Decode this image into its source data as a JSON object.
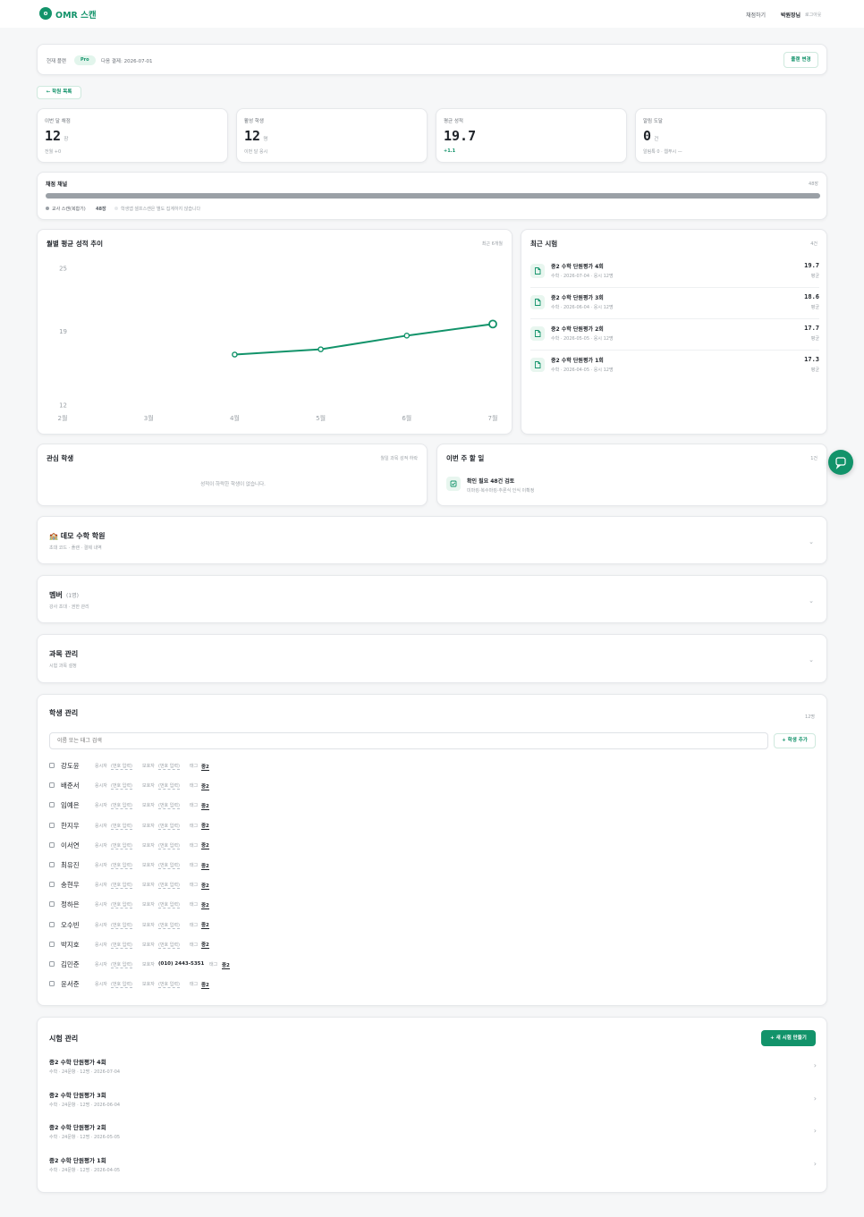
{
  "header": {
    "logo_letter": "o",
    "app_name": "OMR 스캔",
    "nav_scoring": "채점하기",
    "user": "박원장님",
    "logout": "로그아웃"
  },
  "plan": {
    "label": "현재 플랜",
    "badge": "Pro",
    "next_payment": "다음 결제: 2026-07-01",
    "change_button": "플랜 변경"
  },
  "back_button": "← 학원 목록",
  "stats": [
    {
      "label": "이번 달 채점",
      "value": "12",
      "unit": "장",
      "sub": "전월 +0",
      "sub_green": false
    },
    {
      "label": "활성 학생",
      "value": "12",
      "unit": "명",
      "sub": "이번 달 응시",
      "sub_green": false
    },
    {
      "label": "평균 성적",
      "value": "19.7",
      "unit": "",
      "sub": "+1.1",
      "sub_green": true
    },
    {
      "label": "알림 도달",
      "value": "0",
      "unit": "건",
      "sub": "알림톡 0 · 웹푸시 —",
      "sub_green": false
    }
  ],
  "channel": {
    "title": "채점 채널",
    "count": "48장",
    "progress_pct": 100,
    "legend_name": "교사 스캔(복합기)",
    "legend_count": "48장",
    "legend_note": "학생앱 셀프스캔은 별도 집계하지 않습니다"
  },
  "trend": {
    "title": "월별 평균 성적 추이",
    "range": "최근 6개월"
  },
  "chart_data": {
    "type": "line",
    "categories": [
      "2월",
      "3월",
      "4월",
      "5월",
      "6월",
      "7월"
    ],
    "series": [
      {
        "values": [
          null,
          null,
          16.8,
          17.3,
          18.6,
          19.7
        ]
      }
    ],
    "yticks": [
      12,
      19,
      25
    ],
    "ylim": [
      12,
      25
    ],
    "line_color": "#12936a",
    "grid": false
  },
  "recent": {
    "title": "최근 시험",
    "count": "4건",
    "items": [
      {
        "name": "중2 수학 단원평가 4회",
        "meta": "수학 · 2026-07-04 · 응시 12명",
        "score": "19.7",
        "score_label": "평균"
      },
      {
        "name": "중2 수학 단원평가 3회",
        "meta": "수학 · 2026-06-04 · 응시 12명",
        "score": "18.6",
        "score_label": "평균"
      },
      {
        "name": "중2 수학 단원평가 2회",
        "meta": "수학 · 2026-05-05 · 응시 12명",
        "score": "17.7",
        "score_label": "평균"
      },
      {
        "name": "중2 수학 단원평가 1회",
        "meta": "수학 · 2026-04-05 · 응시 12명",
        "score": "17.3",
        "score_label": "평균"
      }
    ]
  },
  "concern": {
    "title": "관심 학생",
    "note": "월일 과목 성적 하락",
    "empty": "성적이 하락한 학생이 없습니다."
  },
  "todo": {
    "title": "이번 주 할 일",
    "count": "1건",
    "item": "확인 필요 48건 검토",
    "item_sub": "미마킹·복수마킹·추론식 인식 이확정"
  },
  "sections": [
    {
      "title": "🏫 데모 수학 학원",
      "sub": "초대 코드 · 플랜 · 결제 내역"
    },
    {
      "title": "멤버",
      "title_suffix": "(1명)",
      "sub": "강사 초대 · 권한 관리"
    },
    {
      "title": "과목 관리",
      "sub": "시험 과목 설정"
    }
  ],
  "students": {
    "title": "학생 관리",
    "count": "12명",
    "search_placeholder": "이름 또는 태그 검색",
    "add_button": "+ 학생 추가",
    "label_id": "응시자",
    "label_parent": "보호자",
    "label_tag": "태그",
    "placeholder_num": "(번호 입력)",
    "tag": "중2",
    "rows": [
      {
        "name": "강도윤",
        "parent": ""
      },
      {
        "name": "배준서",
        "parent": ""
      },
      {
        "name": "임예은",
        "parent": ""
      },
      {
        "name": "한지우",
        "parent": ""
      },
      {
        "name": "이서연",
        "parent": ""
      },
      {
        "name": "최유진",
        "parent": ""
      },
      {
        "name": "송현우",
        "parent": ""
      },
      {
        "name": "정하은",
        "parent": ""
      },
      {
        "name": "오수빈",
        "parent": ""
      },
      {
        "name": "박지호",
        "parent": ""
      },
      {
        "name": "김민준",
        "parent": "(010) 2443-5351"
      },
      {
        "name": "윤서준",
        "parent": ""
      }
    ]
  },
  "exams": {
    "title": "시험 관리",
    "new_button": "+ 새 시험 만들기",
    "items": [
      {
        "name": "중2 수학 단원평가 4회",
        "meta": "수학 · 24문항 · 12명 · 2026-07-04"
      },
      {
        "name": "중2 수학 단원평가 3회",
        "meta": "수학 · 24문항 · 12명 · 2026-06-04"
      },
      {
        "name": "중2 수학 단원평가 2회",
        "meta": "수학 · 24문항 · 12명 · 2026-05-05"
      },
      {
        "name": "중2 수학 단원평가 1회",
        "meta": "수학 · 24문항 · 12명 · 2026-04-05"
      }
    ]
  }
}
